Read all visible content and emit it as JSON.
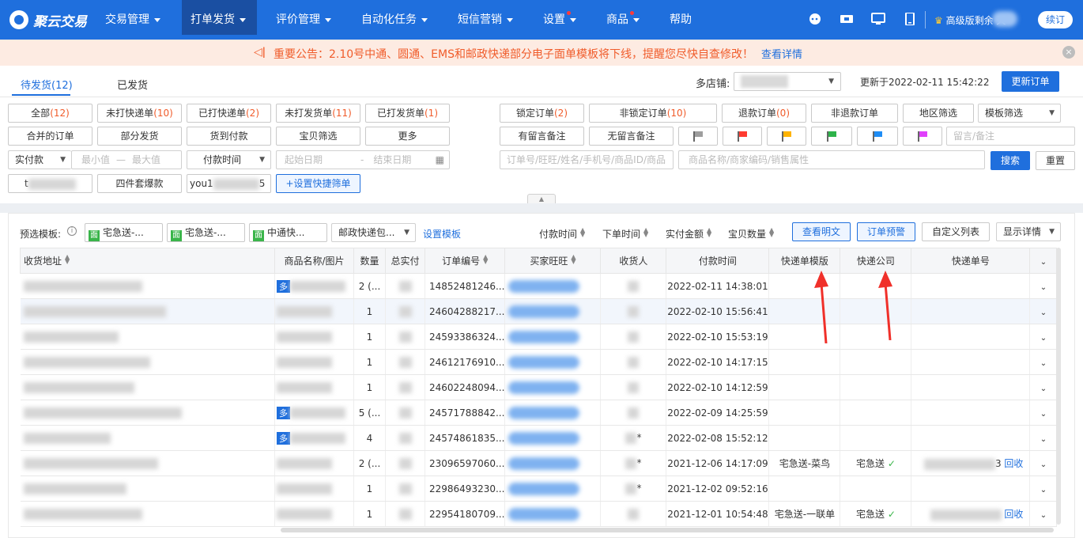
{
  "app": {
    "logo": "聚云交易"
  },
  "nav": {
    "items": [
      {
        "label": "交易管理",
        "caret": true
      },
      {
        "label": "打单发货",
        "caret": true,
        "active": true
      },
      {
        "label": "评价管理",
        "caret": true
      },
      {
        "label": "自动化任务",
        "caret": true
      },
      {
        "label": "短信营销",
        "caret": true
      },
      {
        "label": "设置",
        "caret": true,
        "dot": true
      },
      {
        "label": "商品",
        "caret": true,
        "dot": true
      },
      {
        "label": "帮助"
      }
    ],
    "upgrade": "高级版剩余 天",
    "renew": "续订"
  },
  "notice": {
    "text": "重要公告：2.10号中通、圆通、EMS和邮政快递部分电子面单模板将下线，提醒您尽快自查修改！",
    "link": "查看详情",
    "close": "×"
  },
  "tabs": {
    "pending": "待发货(12)",
    "shipped": "已发货"
  },
  "store": {
    "label": "多店铺:",
    "updated": "更新于2022-02-11 15:42:22",
    "update_btn": "更新订单"
  },
  "filters": {
    "row1": [
      {
        "label": "全部",
        "count": "(12)"
      },
      {
        "label": "未打快递单",
        "count": "(10)"
      },
      {
        "label": "已打快递单",
        "count": "(2)"
      },
      {
        "label": "未打发货单",
        "count": "(11)"
      },
      {
        "label": "已打发货单",
        "count": "(1)"
      }
    ],
    "row1r": [
      {
        "label": "锁定订单",
        "count": "(2)"
      },
      {
        "label": "非锁定订单",
        "count": "(10)"
      },
      {
        "label": "退款订单",
        "count": "(0)"
      },
      {
        "label": "非退款订单",
        "count": ""
      },
      {
        "label": "地区筛选",
        "count": ""
      }
    ],
    "tpl_filter": "模板筛选",
    "row2": [
      "合并的订单",
      "部分发货",
      "货到付款",
      "宝贝筛选",
      "更多"
    ],
    "row2r": [
      "有留言备注",
      "无留言备注"
    ],
    "flags": [
      "#9e9e9e",
      "#ff3b30",
      "#ffb300",
      "#2db34a",
      "#1f8df5",
      "#e040fb"
    ],
    "memo_placeholder": "留言/备注",
    "pay_select": "实付款",
    "min": "最小值",
    "dash": "—",
    "max": "最大值",
    "time_select": "付款时间",
    "start": "起始日期",
    "dash2": "-",
    "end": "结束日期",
    "order_placeholder": "订单号/旺旺/姓名/手机号/商品ID/商品",
    "goods_placeholder": "商品名称/商家编码/销售属性",
    "search": "搜索",
    "reset": "重置",
    "quick1_prefix": "t",
    "quick2": "四件套爆款",
    "quick3_prefix": "you1",
    "quick3_suffix": "5",
    "set_quick": "+设置快捷筛单"
  },
  "toolbar": {
    "preset_label": "预选模板:",
    "info": "i",
    "templates": [
      "宅急送-...",
      "宅急送-...",
      "中通快..."
    ],
    "tpl_badge": "面",
    "postal": "邮政快递包...",
    "set_template": "设置模板",
    "sorts": [
      "付款时间",
      "下单时间",
      "实付金额",
      "宝贝数量"
    ],
    "view_plain": "查看明文",
    "order_alert": "订单预警",
    "custom_cols": "自定义列表",
    "show_detail": "显示详情"
  },
  "table": {
    "headers": [
      "收货地址",
      "商品名称/图片",
      "数量",
      "总实付",
      "订单编号",
      "买家旺旺",
      "收货人",
      "付款时间",
      "快递单模版",
      "快递公司",
      "快递单号",
      ""
    ],
    "rows": [
      {
        "qty": "2 (...",
        "order": "14852481246...",
        "time": "2022-02-11 14:38:01",
        "tpl": "",
        "co": "",
        "no": "",
        "tag": "多",
        "recv": ""
      },
      {
        "qty": "1",
        "order": "24604288217...",
        "time": "2022-02-10 15:56:41",
        "tpl": "",
        "co": "",
        "no": "",
        "tag": "",
        "recv": ""
      },
      {
        "qty": "1",
        "order": "24593386324...",
        "time": "2022-02-10 15:53:19",
        "tpl": "",
        "co": "",
        "no": "",
        "tag": "",
        "recv": ""
      },
      {
        "qty": "1",
        "order": "24612176910...",
        "time": "2022-02-10 14:17:15",
        "tpl": "",
        "co": "",
        "no": "",
        "tag": "",
        "recv": ""
      },
      {
        "qty": "1",
        "order": "24602248094...",
        "time": "2022-02-10 14:12:59",
        "tpl": "",
        "co": "",
        "no": "",
        "tag": "",
        "recv": ""
      },
      {
        "qty": "5 (...",
        "order": "24571788842...",
        "time": "2022-02-09 14:25:59",
        "tpl": "",
        "co": "",
        "no": "",
        "tag": "多",
        "recv": ""
      },
      {
        "qty": "4",
        "order": "24574861835...",
        "time": "2022-02-08 15:52:12",
        "tpl": "",
        "co": "",
        "no": "",
        "tag": "多",
        "recv": "*"
      },
      {
        "qty": "2 (...",
        "order": "23096597060...",
        "time": "2021-12-06 14:17:09",
        "tpl": "宅急送-菜鸟",
        "co": "宅急送",
        "no": "3",
        "recover": "回收",
        "tag": "",
        "recv": "*"
      },
      {
        "qty": "1",
        "order": "22986493230...",
        "time": "2021-12-02 09:52:16",
        "tpl": "",
        "co": "",
        "no": "",
        "tag": "",
        "recv": "*"
      },
      {
        "qty": "1",
        "order": "22954180709...",
        "time": "2021-12-01 10:54:48",
        "tpl": "宅急送-一联单",
        "co": "宅急送",
        "no": "",
        "recover": "回收",
        "tag": "",
        "recv": ""
      }
    ]
  }
}
